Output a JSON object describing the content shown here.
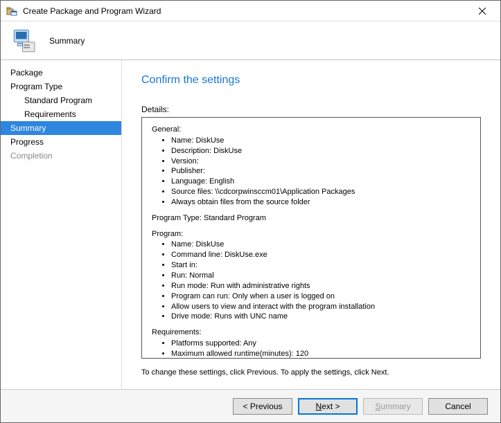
{
  "window": {
    "title": "Create Package and Program Wizard"
  },
  "header": {
    "label": "Summary"
  },
  "nav": {
    "items": [
      {
        "label": "Package",
        "indent": false,
        "state": "normal"
      },
      {
        "label": "Program Type",
        "indent": false,
        "state": "normal"
      },
      {
        "label": "Standard Program",
        "indent": true,
        "state": "normal"
      },
      {
        "label": "Requirements",
        "indent": true,
        "state": "normal"
      },
      {
        "label": "Summary",
        "indent": false,
        "state": "selected"
      },
      {
        "label": "Progress",
        "indent": false,
        "state": "normal"
      },
      {
        "label": "Completion",
        "indent": false,
        "state": "disabled"
      }
    ]
  },
  "content": {
    "heading": "Confirm the settings",
    "details_label": "Details:",
    "details": {
      "general": {
        "title": "General:",
        "items": [
          "Name: DiskUse",
          "Description: DiskUse",
          "Version:",
          "Publisher:",
          "Language: English",
          "Source files: \\\\cdcorpwinsccm01\\Application Packages",
          "Always obtain files from the source folder"
        ]
      },
      "program_type_line": "Program Type: Standard Program",
      "program": {
        "title": "Program:",
        "items": [
          "Name: DiskUse",
          "Command line: DiskUse.exe",
          "Start in:",
          "Run: Normal",
          "Run mode: Run with administrative rights",
          "Program can run: Only when a user is logged on",
          "Allow users to view and interact with the program installation",
          "Drive mode: Runs with UNC name"
        ]
      },
      "requirements": {
        "title": "Requirements:",
        "items": [
          "Platforms supported: Any",
          "Maximum allowed runtime(minutes): 120"
        ]
      }
    },
    "hint": "To change these settings, click Previous. To apply the settings, click Next."
  },
  "footer": {
    "previous": "< Previous",
    "next_prefix": "N",
    "next_suffix": "ext >",
    "summary_prefix": "S",
    "summary_suffix": "ummary",
    "cancel": "Cancel"
  }
}
